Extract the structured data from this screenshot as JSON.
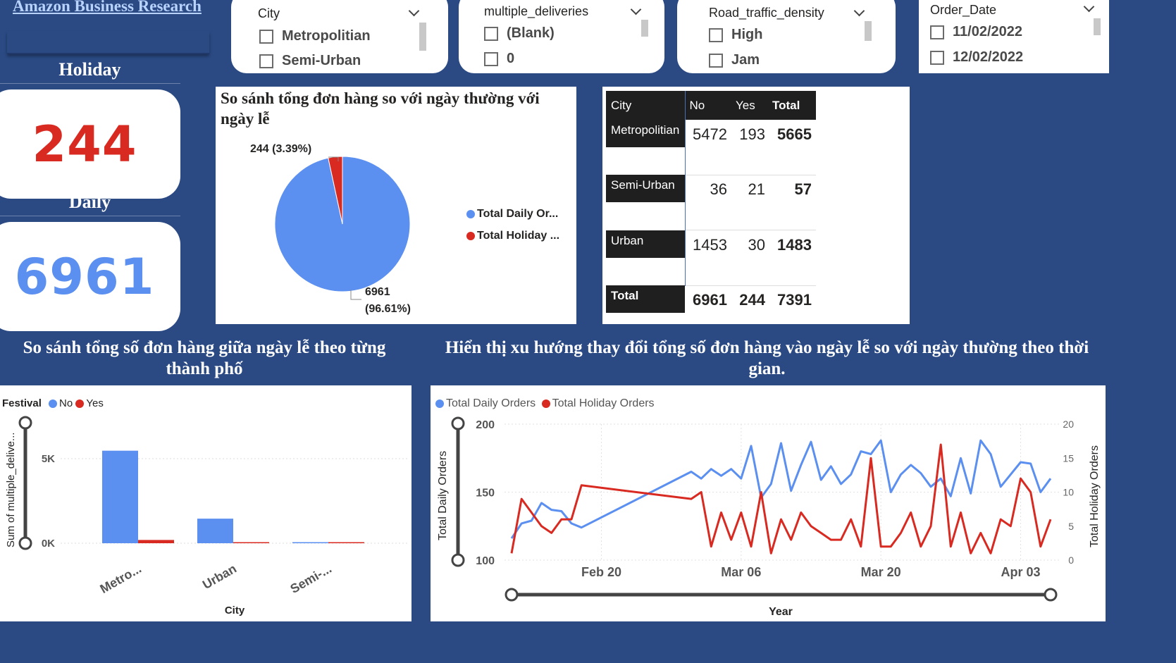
{
  "report_title": "Amazon Business Research",
  "kpis": {
    "holiday_label": "Holiday",
    "holiday_value": "244",
    "daily_label": "Daily",
    "daily_value": "6961"
  },
  "colors": {
    "blue": "#5b8ff0",
    "red": "#d92a21",
    "background": "#2b4a84",
    "matrix_header": "#1f1f1f"
  },
  "slicers": [
    {
      "title": "City",
      "options": [
        "Metropolitian",
        "Semi-Urban"
      ],
      "checked": [
        false,
        false
      ]
    },
    {
      "title": "multiple_deliveries",
      "options": [
        "(Blank)",
        "0"
      ],
      "checked": [
        false,
        false
      ]
    },
    {
      "title": "Road_traffic_density",
      "options": [
        "High",
        "Jam"
      ],
      "checked": [
        false,
        false
      ]
    },
    {
      "title": "Order_Date",
      "options": [
        "11/02/2022",
        "12/02/2022"
      ],
      "checked": [
        false,
        false
      ]
    }
  ],
  "pie": {
    "title": "So sánh tổng đơn hàng so với ngày thường với ngày lễ",
    "label_holiday": "244 (3.39%)",
    "label_daily_1": "6961",
    "label_daily_2": "(96.61%)",
    "legend": [
      "Total Daily Or...",
      "Total Holiday ..."
    ],
    "chart_data": {
      "type": "pie",
      "slices": [
        {
          "name": "Total Daily Orders",
          "value": 6961,
          "percent": 96.61,
          "color": "#5b8ff0"
        },
        {
          "name": "Total Holiday Orders",
          "value": 244,
          "percent": 3.39,
          "color": "#d92a21"
        }
      ]
    }
  },
  "matrix": {
    "headers": [
      "City",
      "No",
      "Yes",
      "Total"
    ],
    "rows": [
      {
        "city": "Metropolitian",
        "no": "5472",
        "yes": "193",
        "total": "5665"
      },
      {
        "city": "Semi-Urban",
        "no": "36",
        "yes": "21",
        "total": "57"
      },
      {
        "city": "Urban",
        "no": "1453",
        "yes": "30",
        "total": "1483"
      }
    ],
    "total": {
      "city": "Total",
      "no": "6961",
      "yes": "244",
      "total": "7391"
    }
  },
  "bar": {
    "title": "So sánh tổng số đơn hàng giữa ngày lễ theo từng thành phố",
    "legend_title": "Festival",
    "legend": [
      "No",
      "Yes"
    ],
    "ylabel": "Sum of multiple_delive...",
    "xlabel": "City",
    "categories": [
      "Metro...",
      "Urban",
      "Semi-..."
    ],
    "yticks": [
      "5K",
      "0K"
    ],
    "chart_data": {
      "type": "bar",
      "categories": [
        "Metropolitian",
        "Urban",
        "Semi-Urban"
      ],
      "series": [
        {
          "name": "No",
          "values": [
            5472,
            1453,
            36
          ]
        },
        {
          "name": "Yes",
          "values": [
            193,
            30,
            21
          ]
        }
      ],
      "ylim": [
        0,
        6000
      ]
    }
  },
  "line": {
    "title": "Hiển thị xu hướng thay đổi tổng số đơn hàng vào ngày lễ so với ngày thường theo thời gian.",
    "legend": [
      "Total Daily Orders",
      "Total Holiday Orders"
    ],
    "ylabel_left": "Total Daily Orders",
    "ylabel_right": "Total Holiday Orders",
    "xlabel": "Year",
    "xticks": [
      "Feb 20",
      "Mar 06",
      "Mar 20",
      "Apr 03"
    ],
    "yticks_left": [
      "200",
      "150",
      "100"
    ],
    "yticks_right": [
      "20",
      "15",
      "10",
      "5",
      "0"
    ],
    "chart_data": {
      "type": "line",
      "x": [
        "2022-02-11",
        "2022-02-12",
        "2022-02-13",
        "2022-02-14",
        "2022-02-15",
        "2022-02-16",
        "2022-02-17",
        "2022-02-18",
        "2022-03-01",
        "2022-03-02",
        "2022-03-03",
        "2022-03-04",
        "2022-03-05",
        "2022-03-06",
        "2022-03-07",
        "2022-03-08",
        "2022-03-09",
        "2022-03-10",
        "2022-03-11",
        "2022-03-12",
        "2022-03-13",
        "2022-03-14",
        "2022-03-15",
        "2022-03-16",
        "2022-03-17",
        "2022-03-18",
        "2022-03-19",
        "2022-03-20",
        "2022-03-21",
        "2022-03-22",
        "2022-03-23",
        "2022-03-24",
        "2022-03-25",
        "2022-03-26",
        "2022-03-27",
        "2022-03-28",
        "2022-03-29",
        "2022-03-30",
        "2022-03-31",
        "2022-04-01",
        "2022-04-02",
        "2022-04-03",
        "2022-04-04",
        "2022-04-05",
        "2022-04-06"
      ],
      "series": [
        {
          "name": "Total Daily Orders",
          "axis": "left",
          "values": [
            116,
            127,
            129,
            142,
            137,
            136,
            127,
            124,
            165,
            160,
            167,
            162,
            167,
            160,
            184,
            146,
            156,
            186,
            151,
            170,
            187,
            159,
            169,
            156,
            163,
            180,
            178,
            188,
            150,
            163,
            170,
            164,
            154,
            160,
            147,
            175,
            149,
            188,
            178,
            154,
            163,
            172,
            171,
            150,
            160
          ]
        },
        {
          "name": "Total Holiday Orders",
          "axis": "right",
          "values": [
            1,
            9,
            7,
            5,
            4,
            6,
            6,
            11,
            9,
            10,
            2,
            7,
            3,
            7,
            2,
            10,
            1,
            6,
            3,
            7,
            5,
            4,
            3,
            3,
            6,
            2,
            15,
            2,
            2,
            4,
            7,
            2,
            5,
            17,
            2,
            7,
            1,
            4,
            1,
            6,
            5,
            12,
            10,
            2,
            6
          ]
        }
      ],
      "ylim_left": [
        100,
        200
      ],
      "ylim_right": [
        0,
        20
      ]
    }
  }
}
